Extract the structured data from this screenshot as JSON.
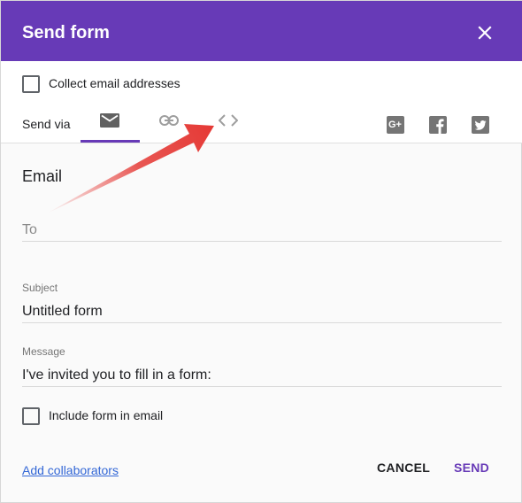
{
  "dialog": {
    "title": "Send form",
    "close_icon": "close-icon"
  },
  "options": {
    "collect_email_label": "Collect email addresses",
    "collect_email_checked": false
  },
  "send_via": {
    "label": "Send via",
    "tabs": [
      {
        "id": "email",
        "icon": "email-icon",
        "selected": true
      },
      {
        "id": "link",
        "icon": "link-icon",
        "selected": false
      },
      {
        "id": "embed",
        "icon": "embed-code-icon",
        "selected": false
      }
    ],
    "social": [
      {
        "id": "google-plus",
        "icon": "google-plus-icon",
        "text": "G+"
      },
      {
        "id": "facebook",
        "icon": "facebook-icon"
      },
      {
        "id": "twitter",
        "icon": "twitter-icon"
      }
    ]
  },
  "email": {
    "section_title": "Email",
    "to_placeholder": "To",
    "to_value": "",
    "subject_label": "Subject",
    "subject_value": "Untitled form",
    "message_label": "Message",
    "message_value": "I've invited you to fill in a form:",
    "include_form_label": "Include form in email",
    "include_form_checked": false
  },
  "footer": {
    "collaborators_link": "Add collaborators",
    "cancel_label": "CANCEL",
    "send_label": "SEND"
  },
  "colors": {
    "header_bg": "#673ab7",
    "accent": "#673ab7",
    "link": "#3367d6",
    "annotation_arrow": "#e53935"
  }
}
